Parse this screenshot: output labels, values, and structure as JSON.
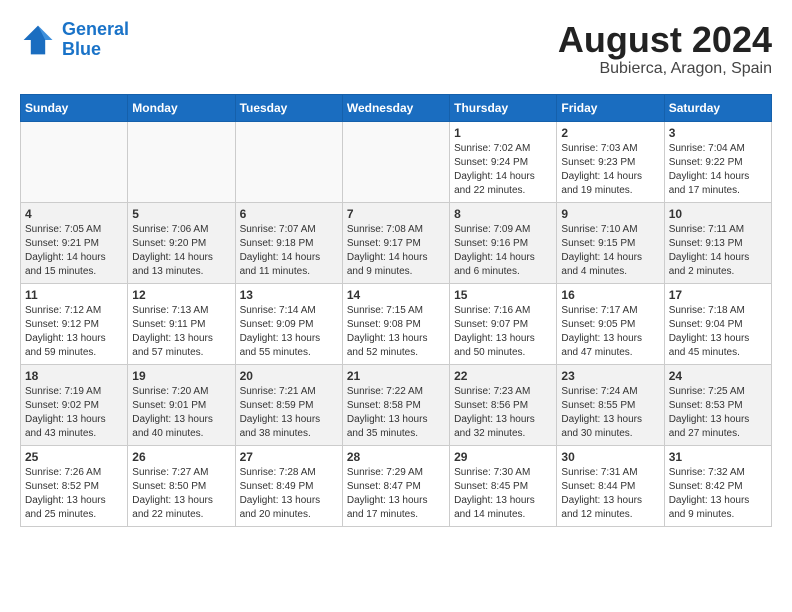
{
  "header": {
    "logo_line1": "General",
    "logo_line2": "Blue",
    "month_title": "August 2024",
    "location": "Bubierca, Aragon, Spain"
  },
  "days_of_week": [
    "Sunday",
    "Monday",
    "Tuesday",
    "Wednesday",
    "Thursday",
    "Friday",
    "Saturday"
  ],
  "weeks": [
    [
      {
        "day": "",
        "info": ""
      },
      {
        "day": "",
        "info": ""
      },
      {
        "day": "",
        "info": ""
      },
      {
        "day": "",
        "info": ""
      },
      {
        "day": "1",
        "info": "Sunrise: 7:02 AM\nSunset: 9:24 PM\nDaylight: 14 hours\nand 22 minutes."
      },
      {
        "day": "2",
        "info": "Sunrise: 7:03 AM\nSunset: 9:23 PM\nDaylight: 14 hours\nand 19 minutes."
      },
      {
        "day": "3",
        "info": "Sunrise: 7:04 AM\nSunset: 9:22 PM\nDaylight: 14 hours\nand 17 minutes."
      }
    ],
    [
      {
        "day": "4",
        "info": "Sunrise: 7:05 AM\nSunset: 9:21 PM\nDaylight: 14 hours\nand 15 minutes."
      },
      {
        "day": "5",
        "info": "Sunrise: 7:06 AM\nSunset: 9:20 PM\nDaylight: 14 hours\nand 13 minutes."
      },
      {
        "day": "6",
        "info": "Sunrise: 7:07 AM\nSunset: 9:18 PM\nDaylight: 14 hours\nand 11 minutes."
      },
      {
        "day": "7",
        "info": "Sunrise: 7:08 AM\nSunset: 9:17 PM\nDaylight: 14 hours\nand 9 minutes."
      },
      {
        "day": "8",
        "info": "Sunrise: 7:09 AM\nSunset: 9:16 PM\nDaylight: 14 hours\nand 6 minutes."
      },
      {
        "day": "9",
        "info": "Sunrise: 7:10 AM\nSunset: 9:15 PM\nDaylight: 14 hours\nand 4 minutes."
      },
      {
        "day": "10",
        "info": "Sunrise: 7:11 AM\nSunset: 9:13 PM\nDaylight: 14 hours\nand 2 minutes."
      }
    ],
    [
      {
        "day": "11",
        "info": "Sunrise: 7:12 AM\nSunset: 9:12 PM\nDaylight: 13 hours\nand 59 minutes."
      },
      {
        "day": "12",
        "info": "Sunrise: 7:13 AM\nSunset: 9:11 PM\nDaylight: 13 hours\nand 57 minutes."
      },
      {
        "day": "13",
        "info": "Sunrise: 7:14 AM\nSunset: 9:09 PM\nDaylight: 13 hours\nand 55 minutes."
      },
      {
        "day": "14",
        "info": "Sunrise: 7:15 AM\nSunset: 9:08 PM\nDaylight: 13 hours\nand 52 minutes."
      },
      {
        "day": "15",
        "info": "Sunrise: 7:16 AM\nSunset: 9:07 PM\nDaylight: 13 hours\nand 50 minutes."
      },
      {
        "day": "16",
        "info": "Sunrise: 7:17 AM\nSunset: 9:05 PM\nDaylight: 13 hours\nand 47 minutes."
      },
      {
        "day": "17",
        "info": "Sunrise: 7:18 AM\nSunset: 9:04 PM\nDaylight: 13 hours\nand 45 minutes."
      }
    ],
    [
      {
        "day": "18",
        "info": "Sunrise: 7:19 AM\nSunset: 9:02 PM\nDaylight: 13 hours\nand 43 minutes."
      },
      {
        "day": "19",
        "info": "Sunrise: 7:20 AM\nSunset: 9:01 PM\nDaylight: 13 hours\nand 40 minutes."
      },
      {
        "day": "20",
        "info": "Sunrise: 7:21 AM\nSunset: 8:59 PM\nDaylight: 13 hours\nand 38 minutes."
      },
      {
        "day": "21",
        "info": "Sunrise: 7:22 AM\nSunset: 8:58 PM\nDaylight: 13 hours\nand 35 minutes."
      },
      {
        "day": "22",
        "info": "Sunrise: 7:23 AM\nSunset: 8:56 PM\nDaylight: 13 hours\nand 32 minutes."
      },
      {
        "day": "23",
        "info": "Sunrise: 7:24 AM\nSunset: 8:55 PM\nDaylight: 13 hours\nand 30 minutes."
      },
      {
        "day": "24",
        "info": "Sunrise: 7:25 AM\nSunset: 8:53 PM\nDaylight: 13 hours\nand 27 minutes."
      }
    ],
    [
      {
        "day": "25",
        "info": "Sunrise: 7:26 AM\nSunset: 8:52 PM\nDaylight: 13 hours\nand 25 minutes."
      },
      {
        "day": "26",
        "info": "Sunrise: 7:27 AM\nSunset: 8:50 PM\nDaylight: 13 hours\nand 22 minutes."
      },
      {
        "day": "27",
        "info": "Sunrise: 7:28 AM\nSunset: 8:49 PM\nDaylight: 13 hours\nand 20 minutes."
      },
      {
        "day": "28",
        "info": "Sunrise: 7:29 AM\nSunset: 8:47 PM\nDaylight: 13 hours\nand 17 minutes."
      },
      {
        "day": "29",
        "info": "Sunrise: 7:30 AM\nSunset: 8:45 PM\nDaylight: 13 hours\nand 14 minutes."
      },
      {
        "day": "30",
        "info": "Sunrise: 7:31 AM\nSunset: 8:44 PM\nDaylight: 13 hours\nand 12 minutes."
      },
      {
        "day": "31",
        "info": "Sunrise: 7:32 AM\nSunset: 8:42 PM\nDaylight: 13 hours\nand 9 minutes."
      }
    ]
  ]
}
